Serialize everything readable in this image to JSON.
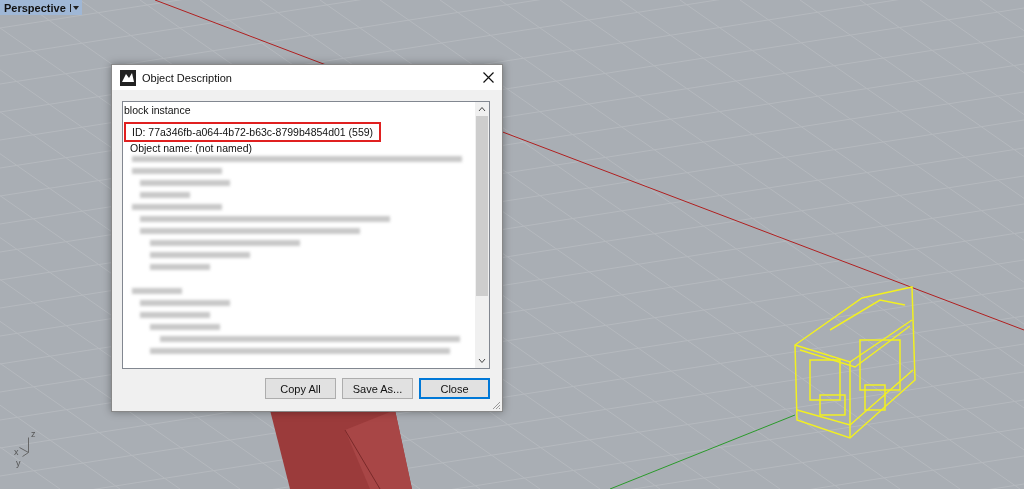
{
  "viewport": {
    "label": "Perspective",
    "axes": [
      {
        "label": "z"
      },
      {
        "label": "x"
      },
      {
        "label": "y"
      }
    ]
  },
  "dialog": {
    "title": "Object Description",
    "lines": [
      {
        "text": "block instance",
        "highlighted": false
      },
      {
        "text": "ID: 77a346fb-a064-4b72-b63c-8799b4854d01 (559)",
        "highlighted": true
      },
      {
        "text": "Object name: (not named)",
        "highlighted": false
      }
    ],
    "buttons": [
      {
        "label": "Copy All",
        "default": false
      },
      {
        "label": "Save As...",
        "default": false
      },
      {
        "label": "Close",
        "default": true
      }
    ]
  }
}
